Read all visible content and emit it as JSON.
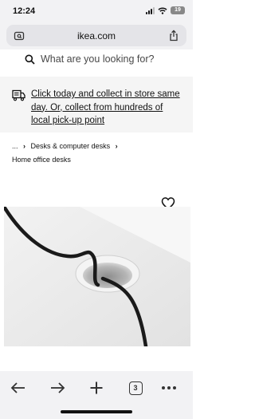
{
  "status_bar": {
    "time": "12:24",
    "battery": "19"
  },
  "browser": {
    "url": "ikea.com"
  },
  "search": {
    "placeholder": "What are you looking for?"
  },
  "banner": {
    "text": "Click today and collect in store same day. Or, collect from hundreds of local pick-up point"
  },
  "breadcrumb": {
    "ellipsis": "...",
    "category": "Desks & computer desks",
    "current": "Home office desks"
  },
  "toolbar": {
    "tab_count": "3"
  },
  "colors": {
    "chrome_bg": "#f2f2f4",
    "url_pill": "#e4e4e8",
    "banner_bg": "#f5f5f5",
    "text": "#111111"
  },
  "icons": [
    "reader-mode-icon",
    "share-icon",
    "search-icon",
    "delivery-truck-icon",
    "heart-icon",
    "back-arrow-icon",
    "forward-arrow-icon",
    "new-tab-plus-icon",
    "tabs-icon",
    "more-icon"
  ]
}
